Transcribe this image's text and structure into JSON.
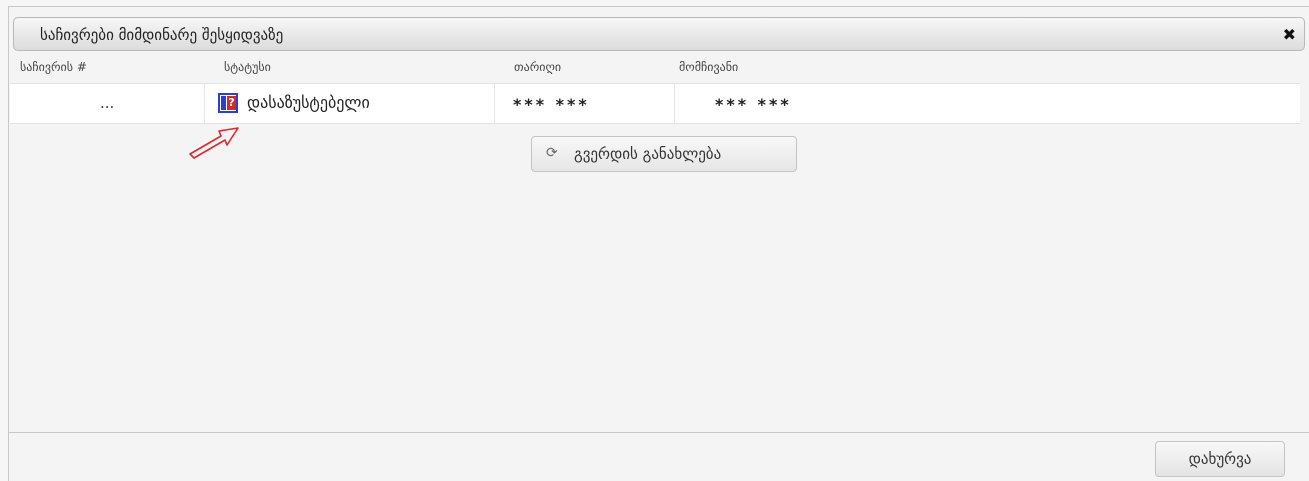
{
  "dialog": {
    "title": "საჩივრები მიმდინარე შესყიდვაზე",
    "close_glyph": "✖"
  },
  "table": {
    "columns": [
      "საჩივრის #",
      "სტატუსი",
      "თარიღი",
      "მომჩივანი"
    ],
    "rows": [
      {
        "number": "...",
        "status_icon": "unconfirmed-status-icon",
        "status_icon_glyph": "?",
        "status": "დასაზუსტებელი",
        "date": "*** ***",
        "complainant": "*** ***"
      }
    ]
  },
  "refresh_button": {
    "icon": "refresh-icon",
    "icon_glyph": "⟳",
    "label": "გვერდის განახლება"
  },
  "close_button": {
    "label": "დახურვა"
  },
  "annotation": {
    "icon": "red-outline-arrow",
    "color": "#e0262e"
  }
}
